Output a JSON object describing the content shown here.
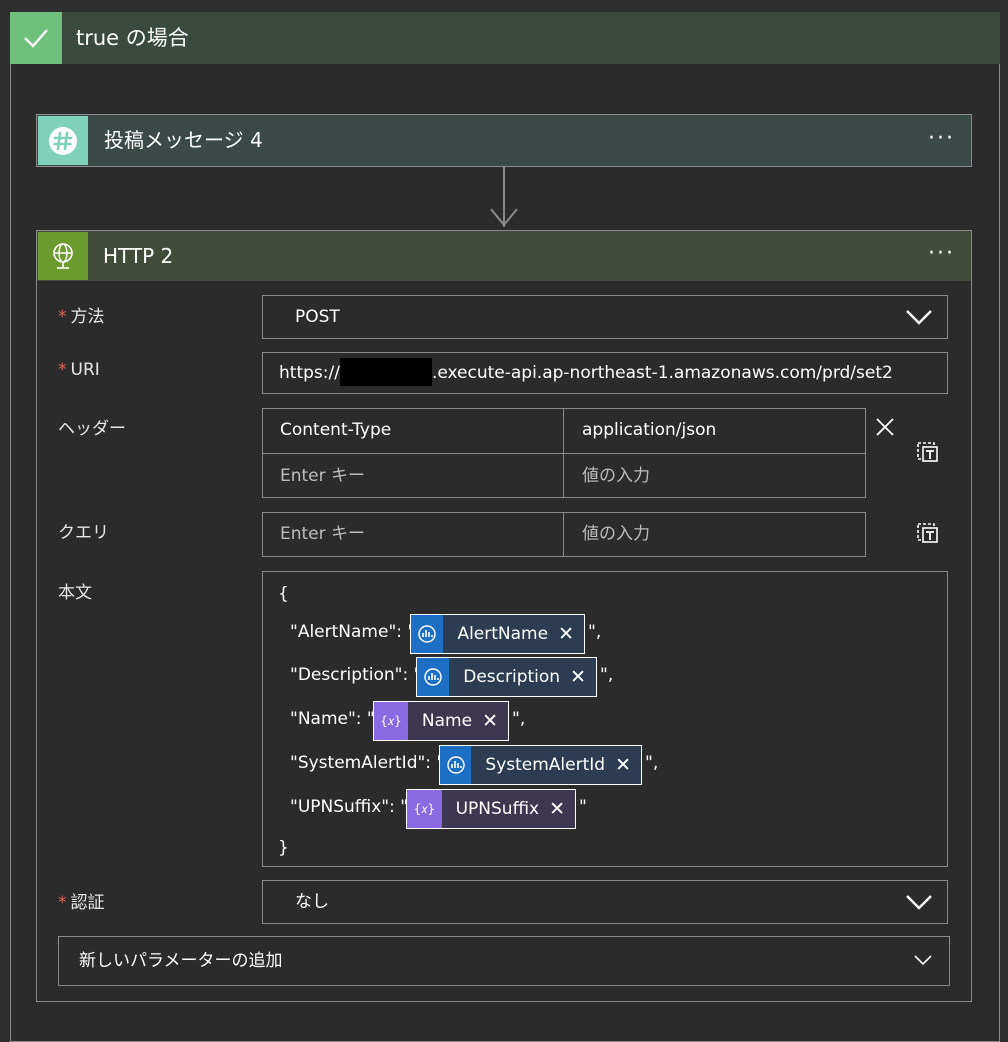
{
  "scope": {
    "title": "true の場合",
    "icon": "checkmark-icon",
    "header_color": "#3a4a3f",
    "check_color": "#6fc07c"
  },
  "slack_action": {
    "title": "投稿メッセージ 4",
    "icon": "slack-icon",
    "menu": "···",
    "icon_color": "#7fd1b9"
  },
  "http_action": {
    "title": "HTTP 2",
    "icon": "globe-icon",
    "menu": "···",
    "icon_color": "#6b9a2e",
    "required_mark": "*",
    "method": {
      "label": "方法",
      "value": "POST"
    },
    "uri": {
      "label": "URI",
      "prefix": "https://",
      "suffix": ".execute-api.ap-northeast-1.amazonaws.com/prd/set2"
    },
    "headers": {
      "label": "ヘッダー",
      "rows": [
        {
          "key": "Content-Type",
          "value": "application/json"
        }
      ],
      "key_placeholder": "Enter キー",
      "value_placeholder": "値の入力"
    },
    "queries": {
      "label": "クエリ",
      "key_placeholder": "Enter キー",
      "value_placeholder": "値の入力"
    },
    "body": {
      "label": "本文",
      "open_brace": "{",
      "close_brace": "}",
      "lines": [
        {
          "key": "\"AlertName\": \"",
          "token": "AlertName",
          "tail": "\",",
          "kind": "blue"
        },
        {
          "key": "\"Description\": \"",
          "token": "Description",
          "tail": "\",",
          "kind": "blue"
        },
        {
          "key": "\"Name\": \"",
          "token": "Name",
          "tail": "\",",
          "kind": "purple"
        },
        {
          "key": "\"SystemAlertId\": \"",
          "token": "SystemAlertId",
          "tail": "\",",
          "kind": "blue"
        },
        {
          "key": "\"UPNSuffix\": \"",
          "token": "UPNSuffix",
          "tail": "\"",
          "kind": "purple"
        }
      ]
    },
    "auth": {
      "label": "認証",
      "value": "なし"
    },
    "add_parameter": {
      "label": "新しいパラメーターの追加"
    }
  }
}
